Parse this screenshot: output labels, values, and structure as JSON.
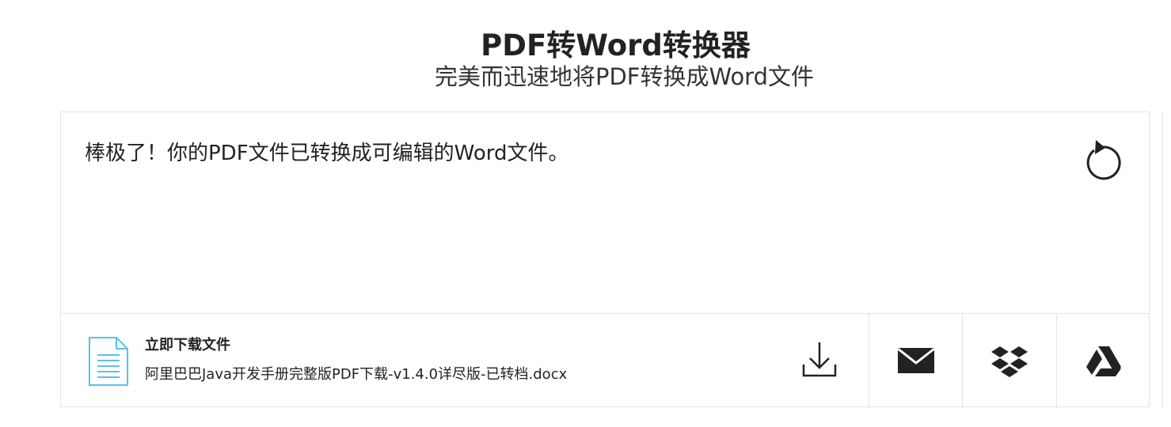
{
  "header": {
    "title": "PDF转Word转换器",
    "subtitle": "完美而迅速地将PDF转换成Word文件"
  },
  "result": {
    "message": "棒极了！你的PDF文件已转换成可编辑的Word文件。",
    "restart_icon": "restart-icon"
  },
  "download": {
    "label": "立即下载文件",
    "filename": "阿里巴巴Java开发手册完整版PDF下载-v1.4.0详尽版-已转档.docx",
    "file_icon": "document-icon",
    "actions": [
      {
        "name": "download",
        "icon": "download-icon"
      },
      {
        "name": "email",
        "icon": "envelope-icon"
      },
      {
        "name": "dropbox",
        "icon": "dropbox-icon"
      },
      {
        "name": "google-drive",
        "icon": "google-drive-icon"
      }
    ]
  },
  "colors": {
    "file_icon": "#5bc0eb",
    "border": "#e3e3e3",
    "text": "#222222"
  }
}
